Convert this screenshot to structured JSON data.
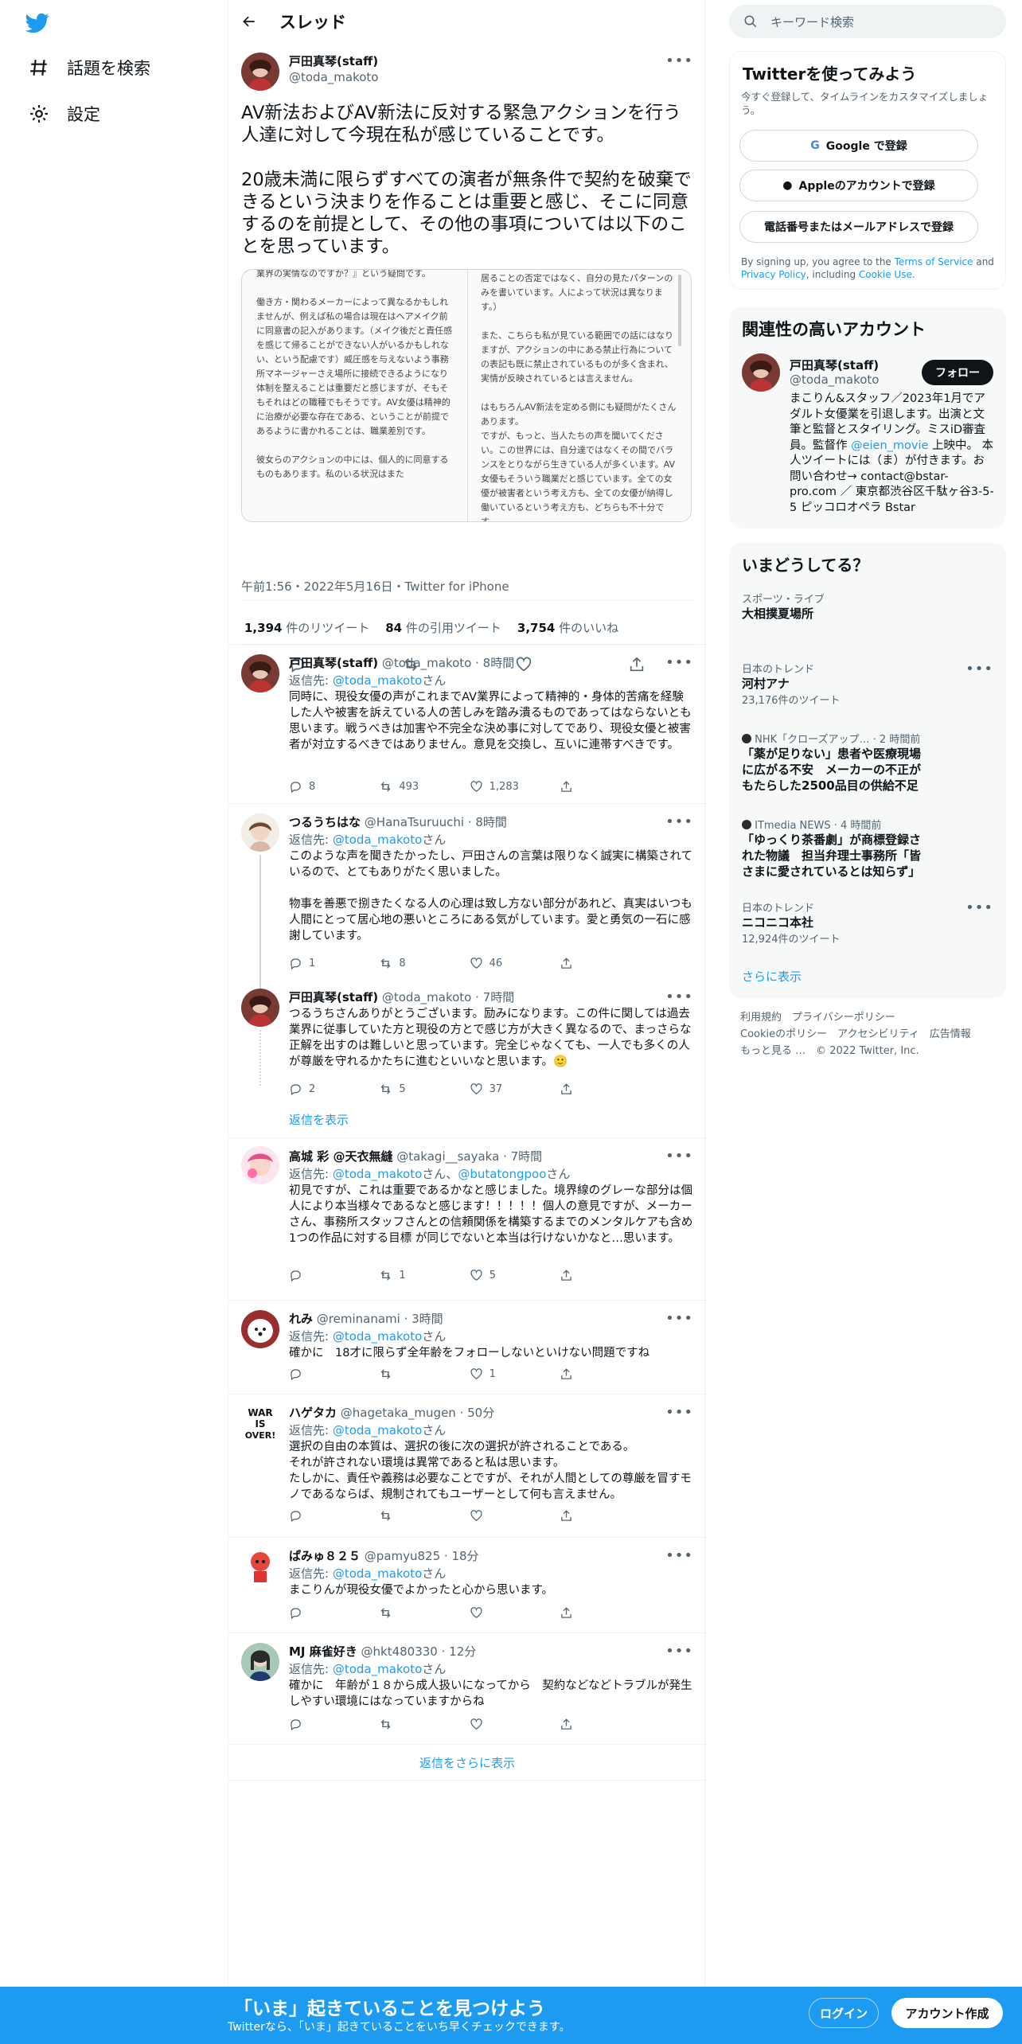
{
  "nav": {
    "explore_label": "話題を検索",
    "settings_label": "設定"
  },
  "header": {
    "title": "スレッド"
  },
  "focus_tweet": {
    "name": "戸田真琴(staff)",
    "handle": "@toda_makoto",
    "text": "AV新法およびAV新法に反対する緊急アクションを行う人達に対して今現在私が感じていることです。\n\n20歳未満に限らずすべての演者が無条件で契約を破棄できるという決まりを作ることは重要と感じ、そこに同意するのを前提として、その他の事項については以下のことを思っています。",
    "media_left": "業界の実情なのですか？』という疑問です。\n\n働き方・関わるメーカーによって異なるかもしれませんが、例えば私の場合は現在はヘアメイク前に同意書の記入があります。（メイク後だと責任感を感じて帰ることができない人がいるかもしれない、という配慮です）威圧感を与えないよう事務所マネージャーさえ場所に接続できるようになり体制を整えることは重要だと感じますが、そもそもそれはどの職種でもそうです。AV女優は精神的に治療が必要な存在である、ということが前提であるように書かれることは、職業差別です。\n\n彼女らのアクションの中には、個人的に同意するものもあります。私のいる状況はまた",
    "media_right": "居ることの否定ではなく、自分の見たパターンのみを書いています。人によって状況は異なります。）\n\nまた、こちらも私が見ている範囲での話にはなりますが、アクションの中にある禁止行為についての表記も既に禁止されているものが多く含まれ、実情が反映されているとは言えません。\n\nはもちろんAV新法を定める側にも疑問がたくさんあります。\nですが、もっと、当人たちの声を聞いてください。この世界には、自分達ではなくその間でバランスをとりながら生きている人が多くいます。AV女優もそういう職業だと感じています。全ての女優が被害者という考え方も、全ての女優が納得し働いているという考え方も、どちらも不十分です。",
    "meta": "午前1:56・2022年5月16日・Twitter for iPhone",
    "retweets": "1,394",
    "retweets_label": "件のリツイート",
    "quotes": "84",
    "quotes_label": "件の引用ツイート",
    "likes": "3,754",
    "likes_label": "件のいいね"
  },
  "replies": [
    {
      "name": "戸田真琴(staff)",
      "handle": "@toda_makoto",
      "time": "8時間",
      "reply_to_prefix": "返信先: ",
      "reply_to": "@toda_makoto",
      "reply_to_suffix": "さん",
      "text": "同時に、現役女優の声がこれまでAV業界によって精神的・身体的苦痛を経験した人や被害を訴えている人の苦しみを踏み潰るものであってはならないとも思います。戦うべきは加害や不完全な決め事に対してであり、現役女優と被害者が対立するべきではありません。意見を交換し、互いに連帯すべきです。",
      "replies": "8",
      "retweets": "493",
      "likes": "1,283"
    },
    {
      "name": "つるうちはな",
      "handle": "@HanaTsuruuchi",
      "time": "8時間",
      "reply_to_prefix": "返信先: ",
      "reply_to": "@toda_makoto",
      "reply_to_suffix": "さん",
      "text": "このような声を聞きたかったし、戸田さんの言葉は限りなく誠実に構築されているので、とてもありがたく思いました。\n\n物事を善悪で捌きたくなる人の心理は致し方ない部分があれど、真実はいつも人間にとって居心地の悪いところにある気がしています。愛と勇気の一石に感謝しています。",
      "replies": "1",
      "retweets": "8",
      "likes": "46"
    },
    {
      "name": "戸田真琴(staff)",
      "handle": "@toda_makoto",
      "time": "7時間",
      "reply_to_prefix": "",
      "reply_to": "",
      "reply_to_suffix": "",
      "text": "つるうちさんありがとうございます。励みになります。この件に関しては過去業界に従事していた方と現役の方とで感じ方が大きく異なるので、まっさらな正解を出すのは難しいと思っています。完全じゃなくても、一人でも多くの人が尊厳を守れるかたちに進むといいなと思います。🙂",
      "replies": "2",
      "retweets": "5",
      "likes": "37",
      "show_replies": "返信を表示"
    },
    {
      "name": "高城 彩 @天衣無縫",
      "handle": "@takagi__sayaka",
      "time": "7時間",
      "reply_to_prefix": "返信先: ",
      "reply_to": "@toda_makoto",
      "reply_to_suffix": "さん、",
      "reply_to2": "@butatongpoo",
      "reply_to2_suffix": "さん",
      "text": "初見ですが、これは重要であるかなと感じました。境界線のグレーな部分は個人により本当様々であるなと感じます！！！！！個人の意見ですが、メーカーさん、事務所スタッフさんとの信頼関係を構築するまでのメンタルケアも含め1つの作品に対する目標 が同じでないと本当は行けないかなと…思います。",
      "replies": "",
      "retweets": "1",
      "likes": "5"
    },
    {
      "name": "れみ",
      "handle": "@reminanami",
      "time": "3時間",
      "reply_to_prefix": "返信先: ",
      "reply_to": "@toda_makoto",
      "reply_to_suffix": "さん",
      "text": "確かに　18才に限らず全年齢をフォローしないといけない問題ですね",
      "replies": "",
      "retweets": "",
      "likes": "1"
    },
    {
      "name": "ハゲタカ",
      "handle": "@hagetaka_mugen",
      "time": "50分",
      "reply_to_prefix": "返信先: ",
      "reply_to": "@toda_makoto",
      "reply_to_suffix": "さん",
      "text": "選択の自由の本質は、選択の後に次の選択が許されることである。\nそれが許されない環境は異常であると私は思います。\nたしかに、責任や義務は必要なことですが、それが人間としての尊厳を冒すモノであるならば、規制されてもユーザーとして何も言えません。",
      "replies": "",
      "retweets": "",
      "likes": ""
    },
    {
      "name": "ぱみゅ８２５",
      "handle": "@pamyu825",
      "time": "18分",
      "reply_to_prefix": "返信先: ",
      "reply_to": "@toda_makoto",
      "reply_to_suffix": "さん",
      "text": "まこりんが現役女優でよかったと心から思います。",
      "replies": "",
      "retweets": "",
      "likes": ""
    },
    {
      "name": "MJ 麻雀好き",
      "handle": "@hkt480330",
      "time": "12分",
      "reply_to_prefix": "返信先: ",
      "reply_to": "@toda_makoto",
      "reply_to_suffix": "さん",
      "text": "確かに　年齢が１８から成人扱いになってから　契約などなどトラブルが発生しやすい環境にはなっていますからね",
      "replies": "",
      "retweets": "",
      "likes": ""
    }
  ],
  "more_replies": "返信をさらに表示",
  "right": {
    "search_placeholder": "キーワード検索",
    "signup_title": "Twitterを使ってみよう",
    "signup_sub": "今すぐ登録して、タイムラインをカスタマイズしましょう。",
    "google_btn": "Google で登録",
    "apple_btn": "Appleのアカウントで登録",
    "phone_btn": "電話番号またはメールアドレスで登録",
    "terms_prefix": "By signing up, you agree to the ",
    "terms_link": "Terms of Service",
    "terms_and": " and ",
    "privacy_link": "Privacy Policy",
    "terms_including": ", including ",
    "cookie_link": "Cookie Use",
    "terms_end": ".",
    "related_title": "関連性の高いアカウント",
    "related_name": "戸田真琴(staff)",
    "related_handle": "@toda_makoto",
    "follow_btn": "フォロー",
    "related_bio_1": "まこりん&スタッフ／2023年1月でアダルト女優業を引退します。出演と文筆と監督とスタイリング。ミスiD審査員。監督作 ",
    "related_bio_link": "@eien_movie",
    "related_bio_2": " 上映中。 本人ツイートには（ま）が付きます。お問い合わせ→ contact@bstar-pro.com ／ 東京都渋谷区千駄ヶ谷3-5-5 ピッコロオペラ Bstar",
    "trends_title": "いまどうしてる？",
    "trends": [
      {
        "cat": "スポーツ・ライブ",
        "name": "大相撲夏場所",
        "count": ""
      },
      {
        "cat": "日本のトレンド",
        "name": "河村アナ",
        "count": "23,176件のツイート"
      },
      {
        "cat": "NHK「クローズアップ… · 2 時間前",
        "name": "「薬が足りない」患者や医療現場に広がる不安　メーカーの不正がもたらした2500品目の供給不足",
        "count": ""
      },
      {
        "cat": "ITmedia NEWS · 4 時間前",
        "name": "「ゆっくり茶番劇」が商標登録された物議　担当弁理士事務所「皆さまに愛されているとは知らず」",
        "count": ""
      },
      {
        "cat": "日本のトレンド",
        "name": "ニコニコ本社",
        "count": "12,924件のツイート"
      }
    ],
    "trends_more": "さらに表示",
    "footer_1": "利用規約　プライバシーポリシー",
    "footer_2": "Cookieのポリシー　アクセシビリティ　広告情報",
    "footer_3": "もっと見る …　© 2022 Twitter, Inc."
  },
  "bottom": {
    "title": "「いま」起きていることを見つけよう",
    "sub": "Twitterなら、「いま」起きていることをいち早くチェックできます。",
    "login": "ログイン",
    "signup": "アカウント作成"
  },
  "colors": {
    "accent": "#1d9bf0",
    "text": "#0f1419",
    "secondary": "#536471"
  }
}
